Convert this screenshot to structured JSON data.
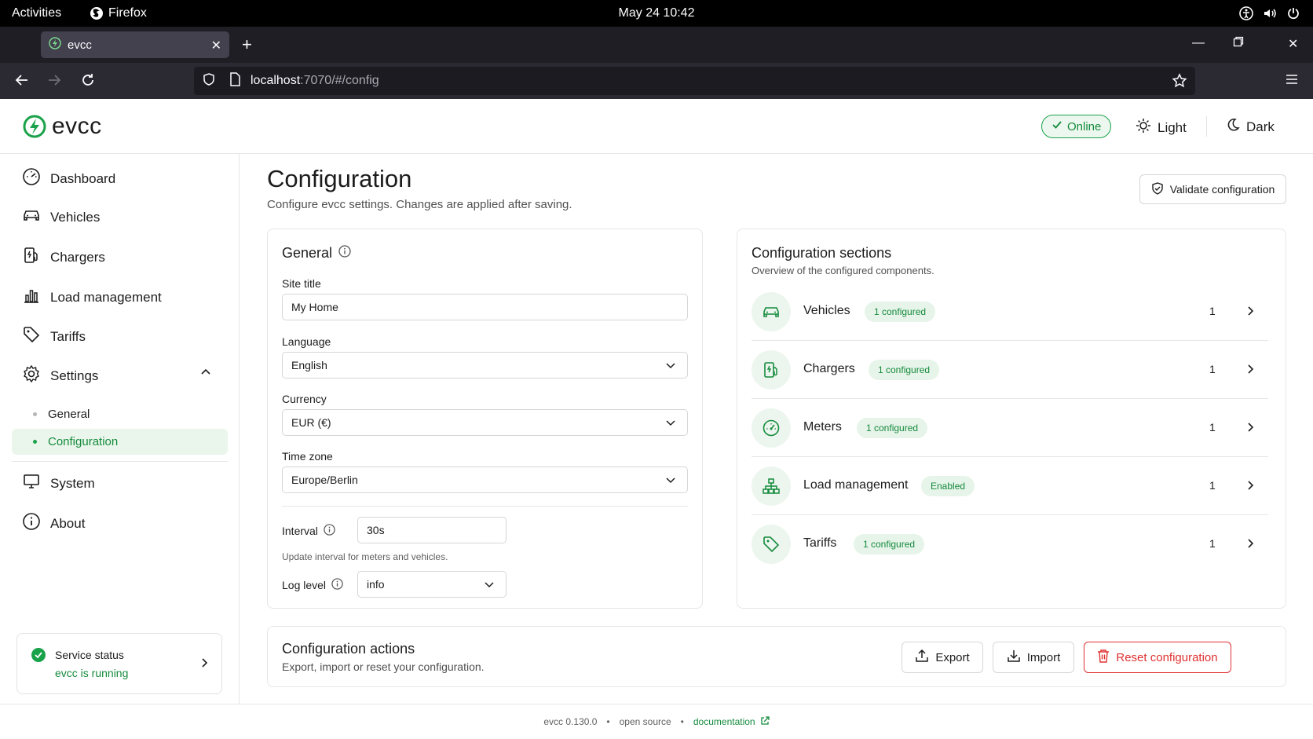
{
  "system_bar": {
    "activities": "Activities",
    "app_name": "Firefox",
    "clock": "May 24  10:42"
  },
  "browser": {
    "tab_title": "evcc",
    "url_host": "localhost",
    "url_path": ":7070/#/config"
  },
  "header": {
    "brand": "evcc",
    "status": "Online",
    "light_label": "Light",
    "dark_label": "Dark"
  },
  "sidebar": {
    "items": [
      {
        "label": "Dashboard",
        "icon": "dashboard-icon"
      },
      {
        "label": "Vehicles",
        "icon": "car-icon"
      },
      {
        "label": "Chargers",
        "icon": "charger-icon"
      },
      {
        "label": "Load management",
        "icon": "bar-chart-icon"
      },
      {
        "label": "Tariffs",
        "icon": "tag-icon"
      },
      {
        "label": "Settings",
        "icon": "gear-icon"
      }
    ],
    "sub_items": [
      {
        "label": "General"
      },
      {
        "label": "Configuration"
      }
    ],
    "bottom_items": [
      {
        "label": "System",
        "icon": "monitor-icon"
      },
      {
        "label": "About",
        "icon": "info-icon"
      }
    ],
    "service": {
      "title": "Service status",
      "status": "evcc is running"
    }
  },
  "page": {
    "title": "Configuration",
    "subtitle": "Configure evcc settings. Changes are applied after saving.",
    "validate_label": "Validate configuration"
  },
  "general": {
    "title": "General",
    "site_title_label": "Site title",
    "site_title_value": "My Home",
    "language_label": "Language",
    "language_value": "English",
    "currency_label": "Currency",
    "currency_value": "EUR (€)",
    "timezone_label": "Time zone",
    "timezone_value": "Europe/Berlin",
    "interval_label": "Interval",
    "interval_value": "30s",
    "interval_hint": "Update interval for meters and vehicles.",
    "loglevel_label": "Log level",
    "loglevel_value": "info"
  },
  "sections": {
    "title": "Configuration sections",
    "subtitle": "Overview of the configured components.",
    "rows": [
      {
        "name": "Vehicles",
        "badge": "1 configured",
        "count": "1",
        "icon": "car-icon"
      },
      {
        "name": "Chargers",
        "badge": "1 configured",
        "count": "1",
        "icon": "charger-icon"
      },
      {
        "name": "Meters",
        "badge": "1 configured",
        "count": "1",
        "icon": "gauge-icon"
      },
      {
        "name": "Load management",
        "badge": "Enabled",
        "count": "1",
        "icon": "hierarchy-icon"
      },
      {
        "name": "Tariffs",
        "badge": "1 configured",
        "count": "1",
        "icon": "tag-icon"
      }
    ]
  },
  "actions": {
    "title": "Configuration actions",
    "subtitle": "Export, import or reset your configuration.",
    "export_label": "Export",
    "import_label": "Import",
    "reset_label": "Reset configuration"
  },
  "footer": {
    "version": "evcc 0.130.0",
    "open_source": "open source",
    "documentation": "documentation"
  },
  "colors": {
    "accent": "#1aa24a",
    "danger": "#e03131"
  }
}
